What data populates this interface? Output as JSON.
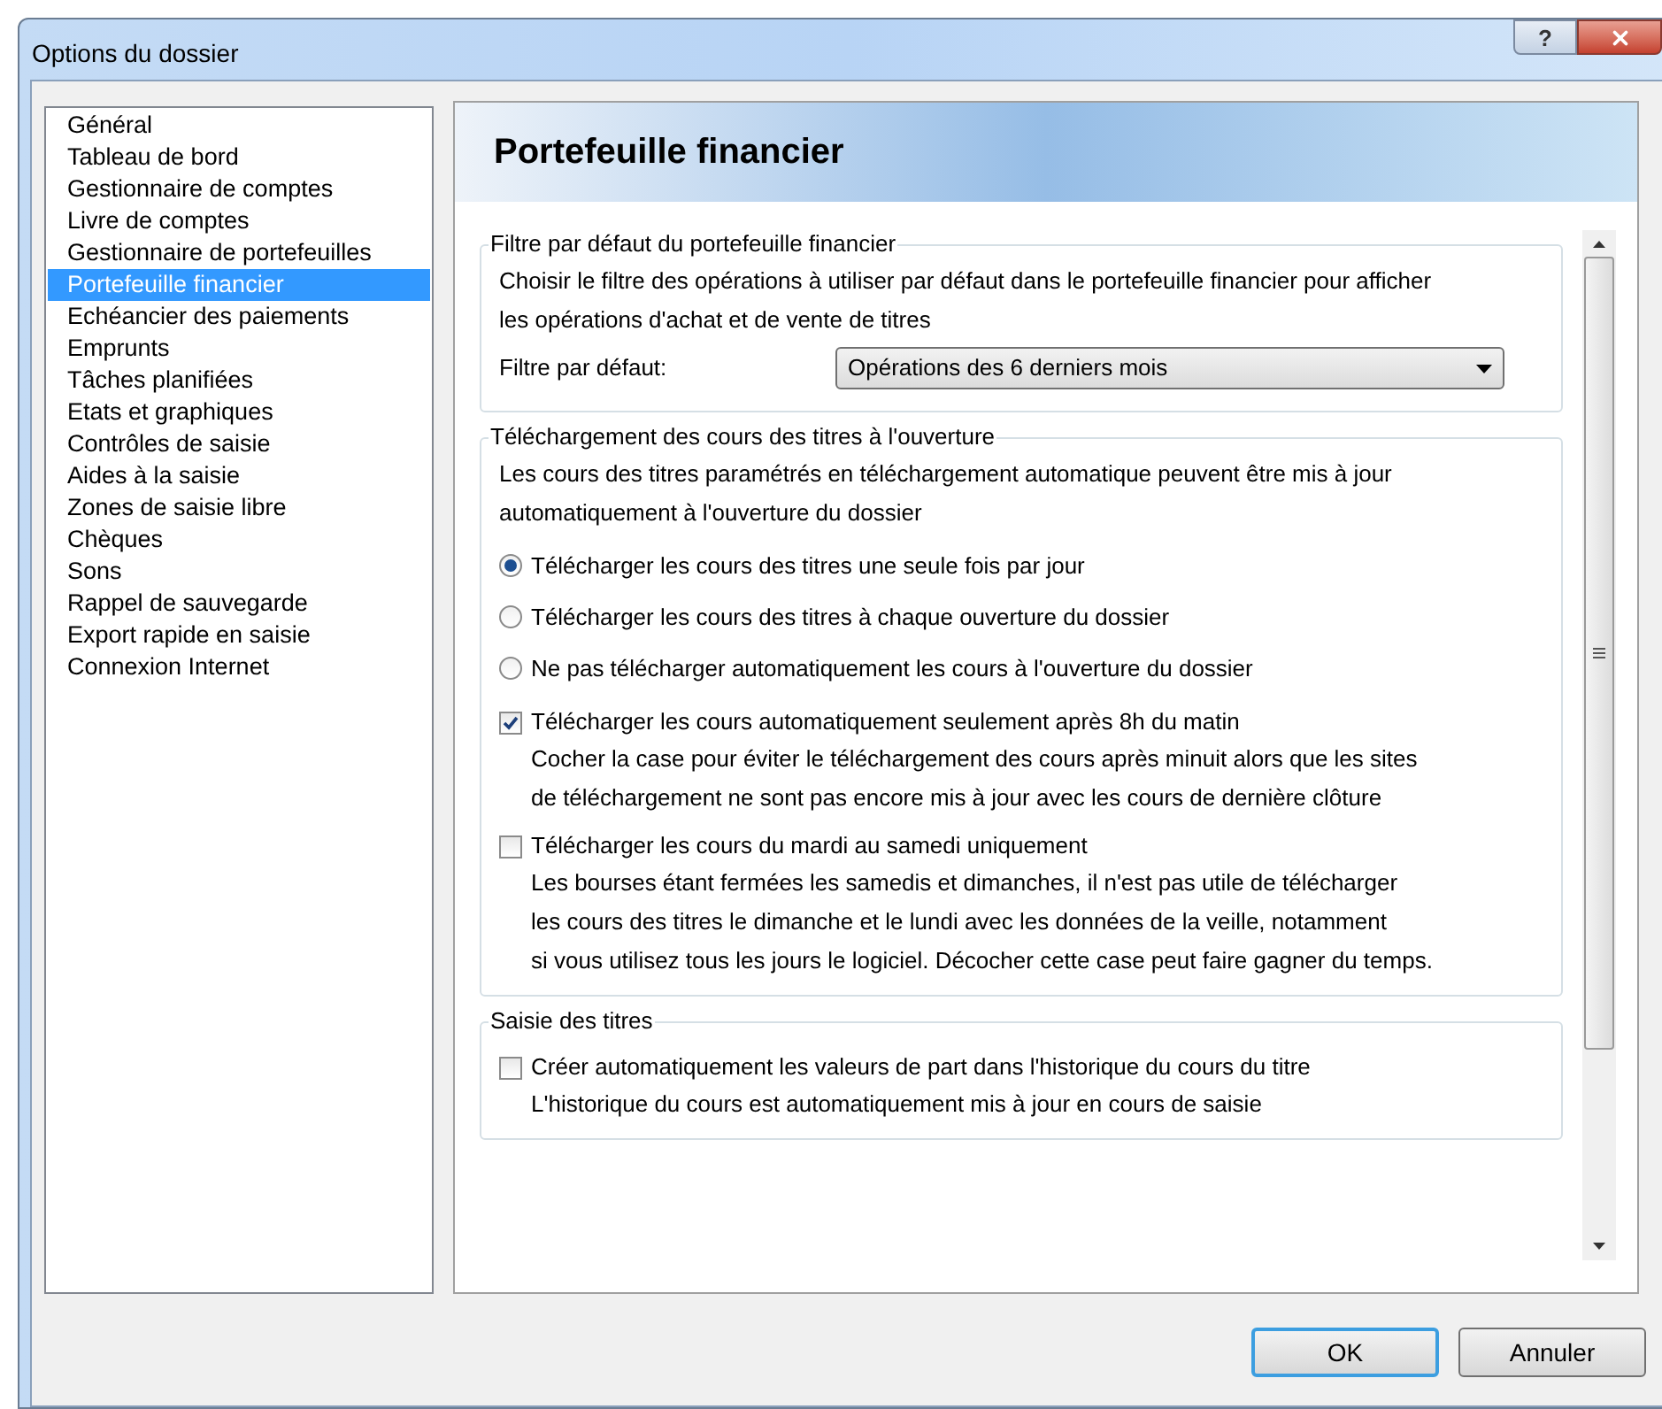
{
  "window": {
    "title": "Options du dossier",
    "help": "?"
  },
  "sidebar": {
    "items": [
      {
        "label": "Général",
        "selected": false
      },
      {
        "label": "Tableau de bord",
        "selected": false
      },
      {
        "label": "Gestionnaire de comptes",
        "selected": false
      },
      {
        "label": "Livre de comptes",
        "selected": false
      },
      {
        "label": "Gestionnaire de portefeuilles",
        "selected": false
      },
      {
        "label": "Portefeuille financier",
        "selected": true
      },
      {
        "label": "Echéancier des paiements",
        "selected": false
      },
      {
        "label": "Emprunts",
        "selected": false
      },
      {
        "label": "Tâches planifiées",
        "selected": false
      },
      {
        "label": "Etats et graphiques",
        "selected": false
      },
      {
        "label": "Contrôles de saisie",
        "selected": false
      },
      {
        "label": "Aides à la saisie",
        "selected": false
      },
      {
        "label": "Zones de saisie libre",
        "selected": false
      },
      {
        "label": "Chèques",
        "selected": false
      },
      {
        "label": "Sons",
        "selected": false
      },
      {
        "label": "Rappel de sauvegarde",
        "selected": false
      },
      {
        "label": "Export rapide en saisie",
        "selected": false
      },
      {
        "label": "Connexion Internet",
        "selected": false
      }
    ]
  },
  "panel": {
    "title": "Portefeuille financier",
    "sections": [
      {
        "title": "Filtre par défaut du portefeuille financier",
        "items": [
          {
            "kind": "text",
            "lines": [
              "Choisir le filtre des opérations à utiliser par défaut dans le portefeuille financier pour afficher",
              "les opérations d'achat et de vente de titres"
            ]
          },
          {
            "kind": "select",
            "label": "Filtre par défaut:",
            "value": "Opérations des 6 derniers mois"
          }
        ]
      },
      {
        "title": "Téléchargement des cours des titres à l'ouverture",
        "items": [
          {
            "kind": "text",
            "lines": [
              "Les cours des titres paramétrés en téléchargement automatique peuvent être mis à jour",
              "automatiquement à l'ouverture du dossier"
            ]
          },
          {
            "kind": "radio",
            "label": "Télécharger les cours des titres une seule fois par jour",
            "selected": true
          },
          {
            "kind": "radio",
            "label": "Télécharger les cours des titres à chaque ouverture du dossier",
            "selected": false
          },
          {
            "kind": "radio",
            "label": "Ne pas télécharger automatiquement les cours à l'ouverture du dossier",
            "selected": false
          },
          {
            "kind": "checkbox",
            "label": "Télécharger les cours automatiquement seulement après 8h du matin",
            "checked": true,
            "lines": [
              "Cocher la case pour éviter le téléchargement des cours après minuit alors que les sites",
              "de téléchargement ne sont pas encore mis à jour avec les cours de dernière clôture"
            ]
          },
          {
            "kind": "checkbox",
            "label": "Télécharger les cours du mardi au samedi uniquement",
            "checked": false,
            "lines": [
              "Les bourses étant fermées les samedis et dimanches, il n'est pas utile de télécharger",
              "les cours des titres le dimanche et le lundi avec les données de la veille, notamment",
              "si vous utilisez tous les jours le logiciel. Décocher cette case peut faire gagner du temps."
            ]
          }
        ]
      },
      {
        "title": "Saisie des titres",
        "items": [
          {
            "kind": "checkbox",
            "label": "Créer automatiquement les valeurs de part dans l'historique du cours du titre",
            "checked": false,
            "lines": [
              "L'historique du cours est automatiquement mis à jour en cours de saisie"
            ]
          }
        ]
      }
    ]
  },
  "buttons": [
    {
      "label": "OK",
      "default": true
    },
    {
      "label": "Annuler",
      "default": false
    }
  ]
}
